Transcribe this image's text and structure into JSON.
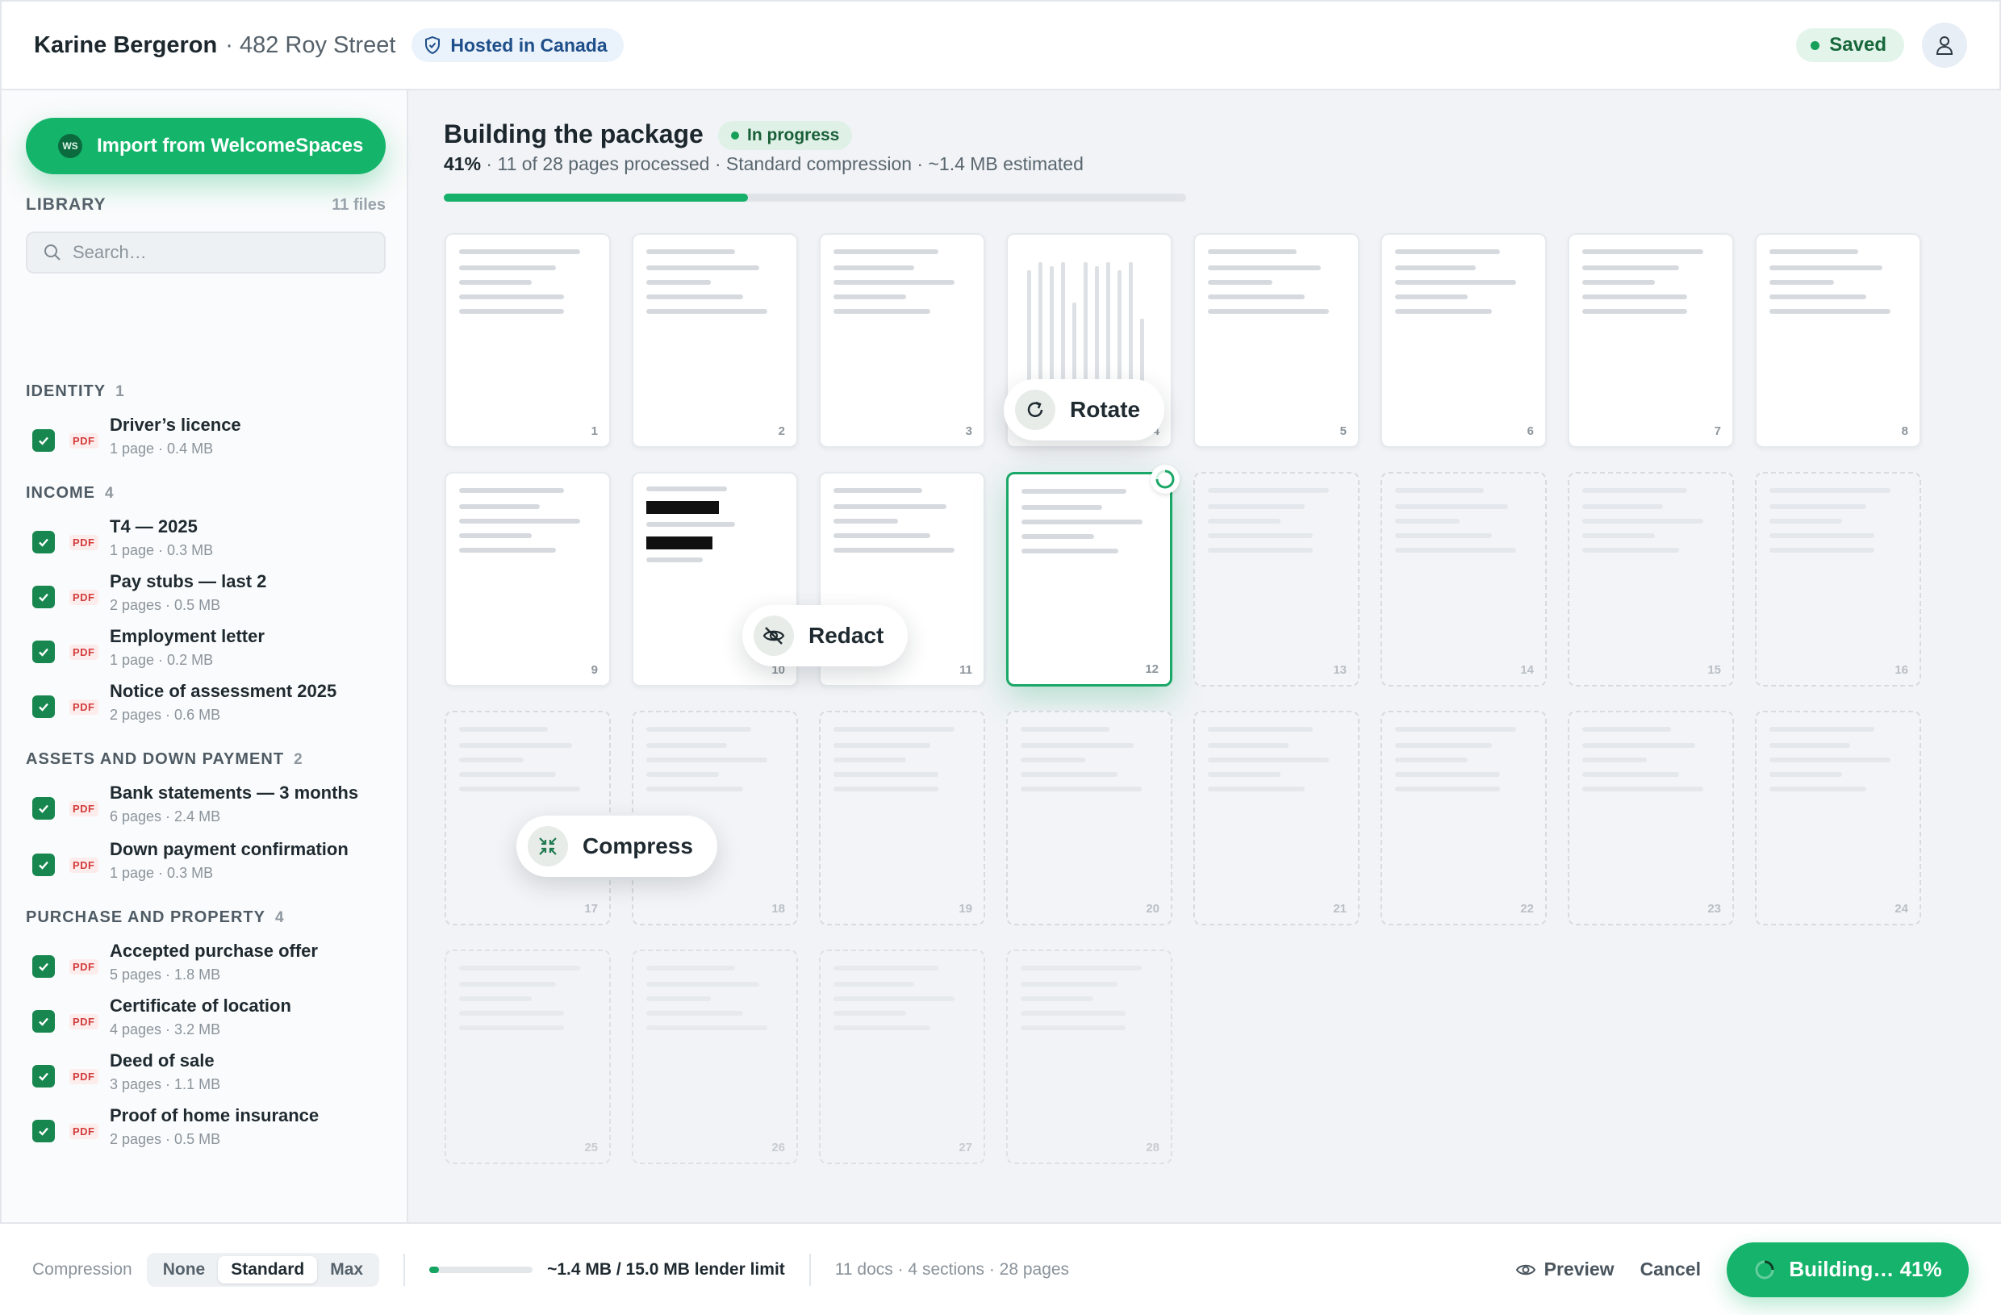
{
  "header": {
    "client_name": "Karine Bergeron",
    "client_address": "· 482 Roy Street",
    "hosting_badge": "Hosted in Canada",
    "saved_status": "Saved",
    "avatar_icon": "user-icon"
  },
  "sidebar": {
    "import_button": "Import from WelcomeSpaces",
    "import_logo": "WS",
    "library_title": "LIBRARY",
    "library_count": "11 files",
    "search_placeholder": "Search…",
    "file_type": "PDF",
    "sections": [
      {
        "title": "IDENTITY",
        "count": "1",
        "files": [
          {
            "name": "Driver’s licence",
            "meta": "1 page · 0.4 MB",
            "checked": true
          }
        ]
      },
      {
        "title": "INCOME",
        "count": "4",
        "files": [
          {
            "name": "T4 — 2025",
            "meta": "1 page · 0.3 MB",
            "checked": true
          },
          {
            "name": "Pay stubs — last 2",
            "meta": "2 pages · 0.5 MB",
            "checked": true
          },
          {
            "name": "Employment letter",
            "meta": "1 page · 0.2 MB",
            "checked": true
          },
          {
            "name": "Notice of assessment 2025",
            "meta": "2 pages · 0.6 MB",
            "checked": true
          }
        ]
      },
      {
        "title": "ASSETS AND DOWN PAYMENT",
        "count": "2",
        "files": [
          {
            "name": "Bank statements — 3 months",
            "meta": "6 pages · 2.4 MB",
            "checked": true
          },
          {
            "name": "Down payment confirmation",
            "meta": "1 page · 0.3 MB",
            "checked": true
          }
        ]
      },
      {
        "title": "PURCHASE AND PROPERTY",
        "count": "4",
        "files": [
          {
            "name": "Accepted purchase offer",
            "meta": "5 pages · 1.8 MB",
            "checked": true
          },
          {
            "name": "Certificate of location",
            "meta": "4 pages · 3.2 MB",
            "checked": true
          },
          {
            "name": "Deed of sale",
            "meta": "3 pages · 1.1 MB",
            "checked": true
          },
          {
            "name": "Proof of home insurance",
            "meta": "2 pages · 0.5 MB",
            "checked": true
          }
        ]
      }
    ]
  },
  "main": {
    "title": "Building the package",
    "status_badge": "In progress",
    "percent": "41%",
    "details": " · 11 of 28 pages processed · Standard compression · ~1.4 MB estimated",
    "progress_fraction": 0.41,
    "pages": [
      {
        "num": "1",
        "state": "done"
      },
      {
        "num": "2",
        "state": "done"
      },
      {
        "num": "3",
        "state": "done"
      },
      {
        "num": "4",
        "state": "done"
      },
      {
        "num": "5",
        "state": "done"
      },
      {
        "num": "6",
        "state": "done"
      },
      {
        "num": "7",
        "state": "done"
      },
      {
        "num": "8",
        "state": "done"
      },
      {
        "num": "9",
        "state": "done"
      },
      {
        "num": "10",
        "state": "done"
      },
      {
        "num": "11",
        "state": "done"
      },
      {
        "num": "12",
        "state": "processing"
      },
      {
        "num": "13",
        "state": "pending"
      },
      {
        "num": "14",
        "state": "pending"
      },
      {
        "num": "15",
        "state": "pending"
      },
      {
        "num": "16",
        "state": "pending"
      },
      {
        "num": "17",
        "state": "pending"
      },
      {
        "num": "18",
        "state": "pending"
      },
      {
        "num": "19",
        "state": "pending"
      },
      {
        "num": "20",
        "state": "pending"
      },
      {
        "num": "21",
        "state": "pending"
      },
      {
        "num": "22",
        "state": "pending"
      },
      {
        "num": "23",
        "state": "pending"
      },
      {
        "num": "24",
        "state": "pending"
      },
      {
        "num": "25",
        "state": "pending"
      },
      {
        "num": "26",
        "state": "pending"
      },
      {
        "num": "27",
        "state": "pending"
      },
      {
        "num": "28",
        "state": "pending"
      }
    ],
    "tooltips": {
      "rotate": "Rotate",
      "redact": "Redact",
      "compress": "Compress"
    }
  },
  "footer": {
    "compression_label": "Compression",
    "compression_options": [
      "None",
      "Standard",
      "Max"
    ],
    "compression_selected": "Standard",
    "size_fraction": 0.093,
    "size_text": "~1.4 MB / 15.0 MB lender limit",
    "summary": "11 docs · 4 sections · 28 pages",
    "preview_label": "Preview",
    "cancel_label": "Cancel",
    "build_label": "Building… 41%"
  },
  "colors": {
    "accent": "#14b56b",
    "accent_dark": "#17874f",
    "pdf_red": "#d23c3c",
    "hosted_blue": "#1e4f8a"
  }
}
